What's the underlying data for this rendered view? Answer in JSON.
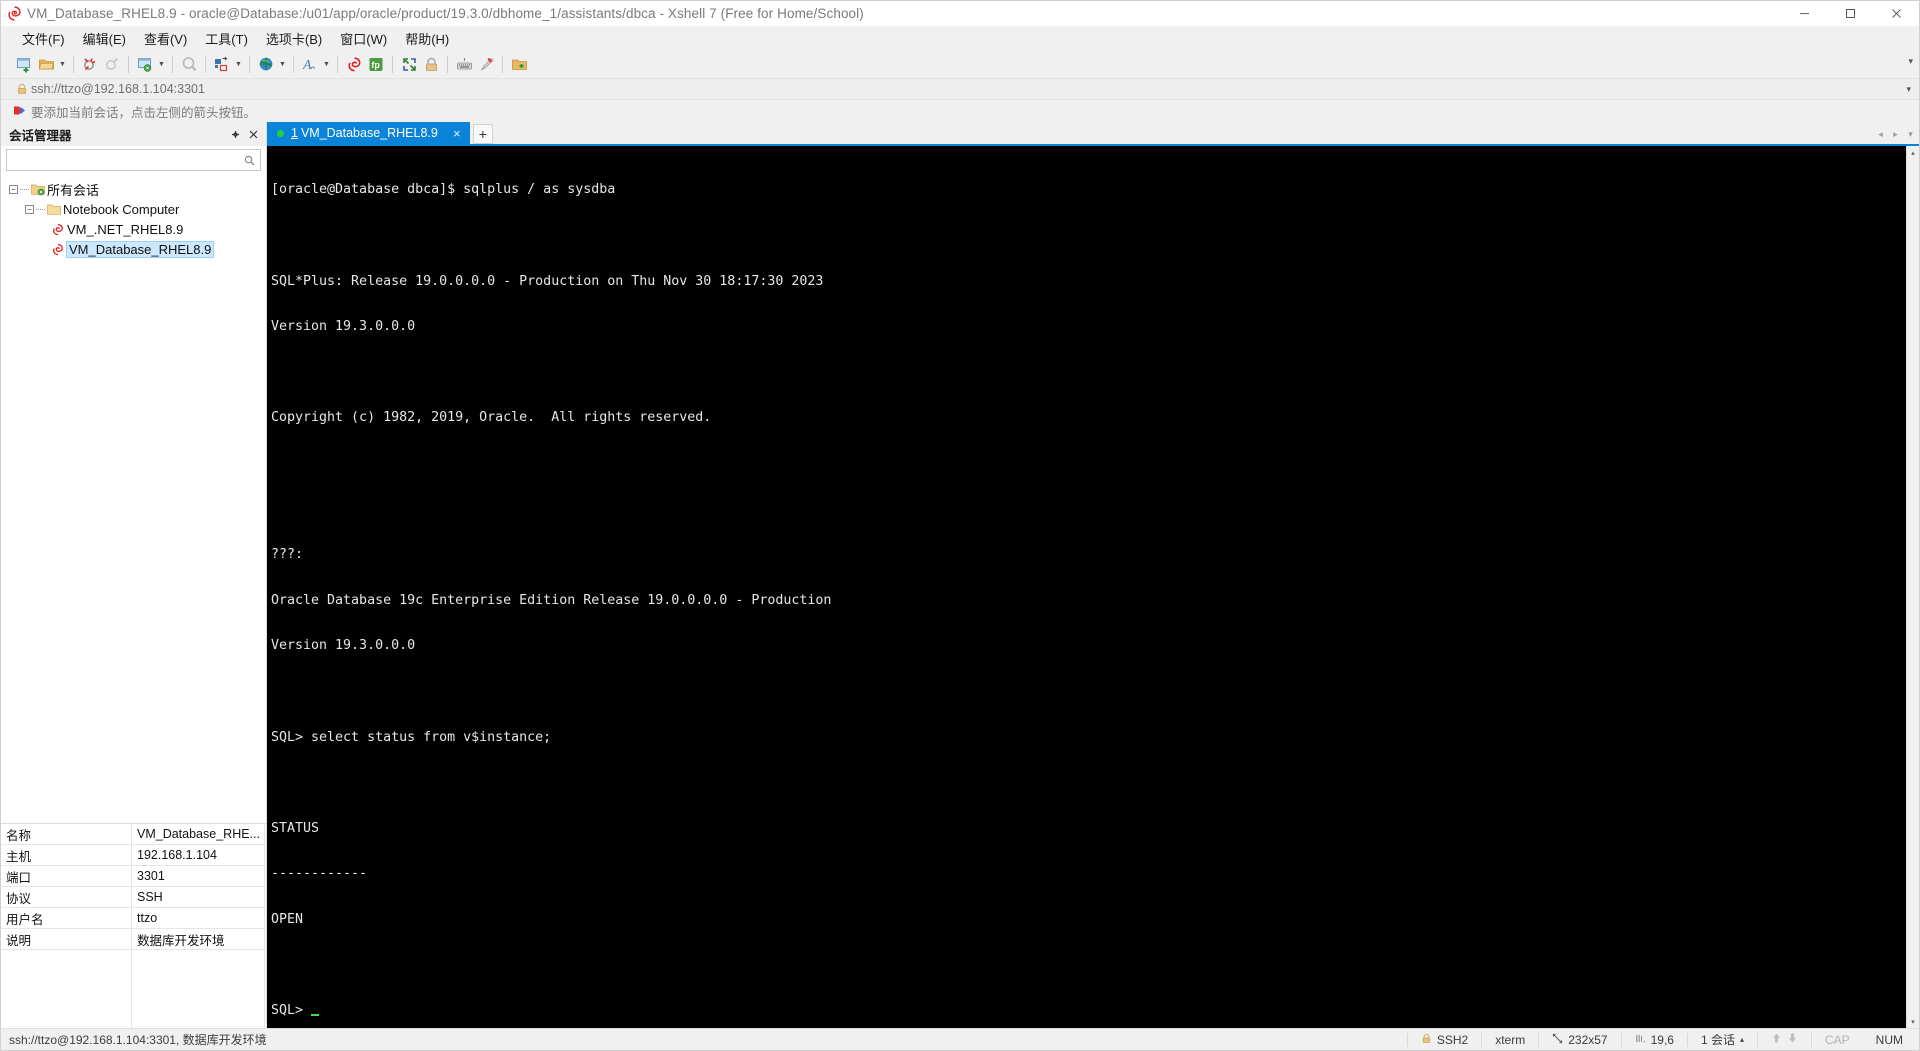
{
  "window": {
    "title": "VM_Database_RHEL8.9 - oracle@Database:/u01/app/oracle/product/19.3.0/dbhome_1/assistants/dbca - Xshell 7 (Free for Home/School)",
    "minimize_label": "—",
    "maximize_label": "❐",
    "close_label": "✕"
  },
  "menubar": {
    "items": [
      {
        "label": "文件(F)",
        "name": "menu-file"
      },
      {
        "label": "编辑(E)",
        "name": "menu-edit"
      },
      {
        "label": "查看(V)",
        "name": "menu-view"
      },
      {
        "label": "工具(T)",
        "name": "menu-tools"
      },
      {
        "label": "选项卡(B)",
        "name": "menu-tabs"
      },
      {
        "label": "窗口(W)",
        "name": "menu-window"
      },
      {
        "label": "帮助(H)",
        "name": "menu-help"
      }
    ]
  },
  "toolbar": {
    "overflow_label": "▾",
    "buttons": [
      "new-session-icon",
      "open-folder-icon",
      "disconnect-icon",
      "reconnect-icon",
      "session-properties-icon",
      "find-icon",
      "layout-icon",
      "transfer-globe-icon",
      "font-icon",
      "xshell-icon",
      "xftp-icon",
      "fullscreen-icon",
      "lock-icon",
      "keyboard-icon",
      "highlight-icon",
      "folder-plus-icon"
    ]
  },
  "address_bar": {
    "value": "ssh://ttzo@192.168.1.104:3301",
    "lock_icon": "lock-icon",
    "dropdown_label": "▾"
  },
  "hint_bar": {
    "icon": "red-arrow-icon",
    "text": "要添加当前会话，点击左侧的箭头按钮。"
  },
  "sidebar": {
    "title": "会话管理器",
    "pin_label": "⇱",
    "close_label": "✕",
    "search_placeholder": "",
    "search_value": "",
    "search_icon": "search-icon",
    "tree": [
      {
        "label": "所有会话",
        "level": 0,
        "icon": "all-sessions-folder-icon",
        "expander": "−",
        "selected": false,
        "name": "tree-item-all-sessions"
      },
      {
        "label": "Notebook Computer",
        "level": 1,
        "icon": "folder-icon",
        "expander": "−",
        "selected": false,
        "name": "tree-item-notebook-computer"
      },
      {
        "label": "VM_.NET_RHEL8.9",
        "level": 2,
        "icon": "session-icon",
        "expander": "",
        "selected": false,
        "name": "tree-item-vm-net-rhel89"
      },
      {
        "label": "VM_Database_RHEL8.9",
        "level": 2,
        "icon": "session-icon",
        "expander": "",
        "selected": true,
        "name": "tree-item-vm-database-rhel89"
      }
    ],
    "properties": [
      {
        "key": "名称",
        "value": "VM_Database_RHE..."
      },
      {
        "key": "主机",
        "value": "192.168.1.104"
      },
      {
        "key": "端口",
        "value": "3301"
      },
      {
        "key": "协议",
        "value": "SSH"
      },
      {
        "key": "用户名",
        "value": "ttzo"
      },
      {
        "key": "说明",
        "value": "数据库开发环境"
      }
    ]
  },
  "tabs": {
    "items": [
      {
        "number": "1",
        "title": "VM_Database_RHEL8.9",
        "active": true,
        "close_label": "×",
        "status_color": "#27d13c"
      }
    ],
    "add_label": "+",
    "nav_left": "◂",
    "nav_right": "▸",
    "nav_menu": "▾"
  },
  "terminal": {
    "lines": [
      "[oracle@Database dbca]$ sqlplus / as sysdba",
      "",
      "SQL*Plus: Release 19.0.0.0.0 - Production on Thu Nov 30 18:17:30 2023",
      "Version 19.3.0.0.0",
      "",
      "Copyright (c) 1982, 2019, Oracle.  All rights reserved.",
      "",
      "",
      "???:",
      "Oracle Database 19c Enterprise Edition Release 19.0.0.0.0 - Production",
      "Version 19.3.0.0.0",
      "",
      "SQL> select status from v$instance;",
      "",
      "STATUS",
      "------------",
      "OPEN",
      "",
      "SQL> "
    ],
    "scroll_up_label": "▴",
    "scroll_down_label": "▾"
  },
  "statusbar": {
    "connection": "ssh://ttzo@192.168.1.104:3301, 数据库开发环境",
    "protocol": "SSH2",
    "protocol_icon": "lock-icon",
    "terminal_type": "xterm",
    "size": "232x57",
    "size_icon": "resize-icon",
    "cursor_pos": "19,6",
    "cursor_icon": "cursor-icon",
    "sessions": "1 会话",
    "sessions_caret": "▴",
    "upload_icon": "upload-arrow-icon",
    "download_icon": "download-arrow-icon",
    "caps": "CAP",
    "num": "NUM"
  },
  "colors": {
    "accent": "#0a84d8",
    "terminal_bg": "#000000",
    "terminal_fg": "#e6e6e6",
    "chrome": "#f0f0f0",
    "selection": "#cce8ff",
    "green_dot": "#27d13c"
  }
}
